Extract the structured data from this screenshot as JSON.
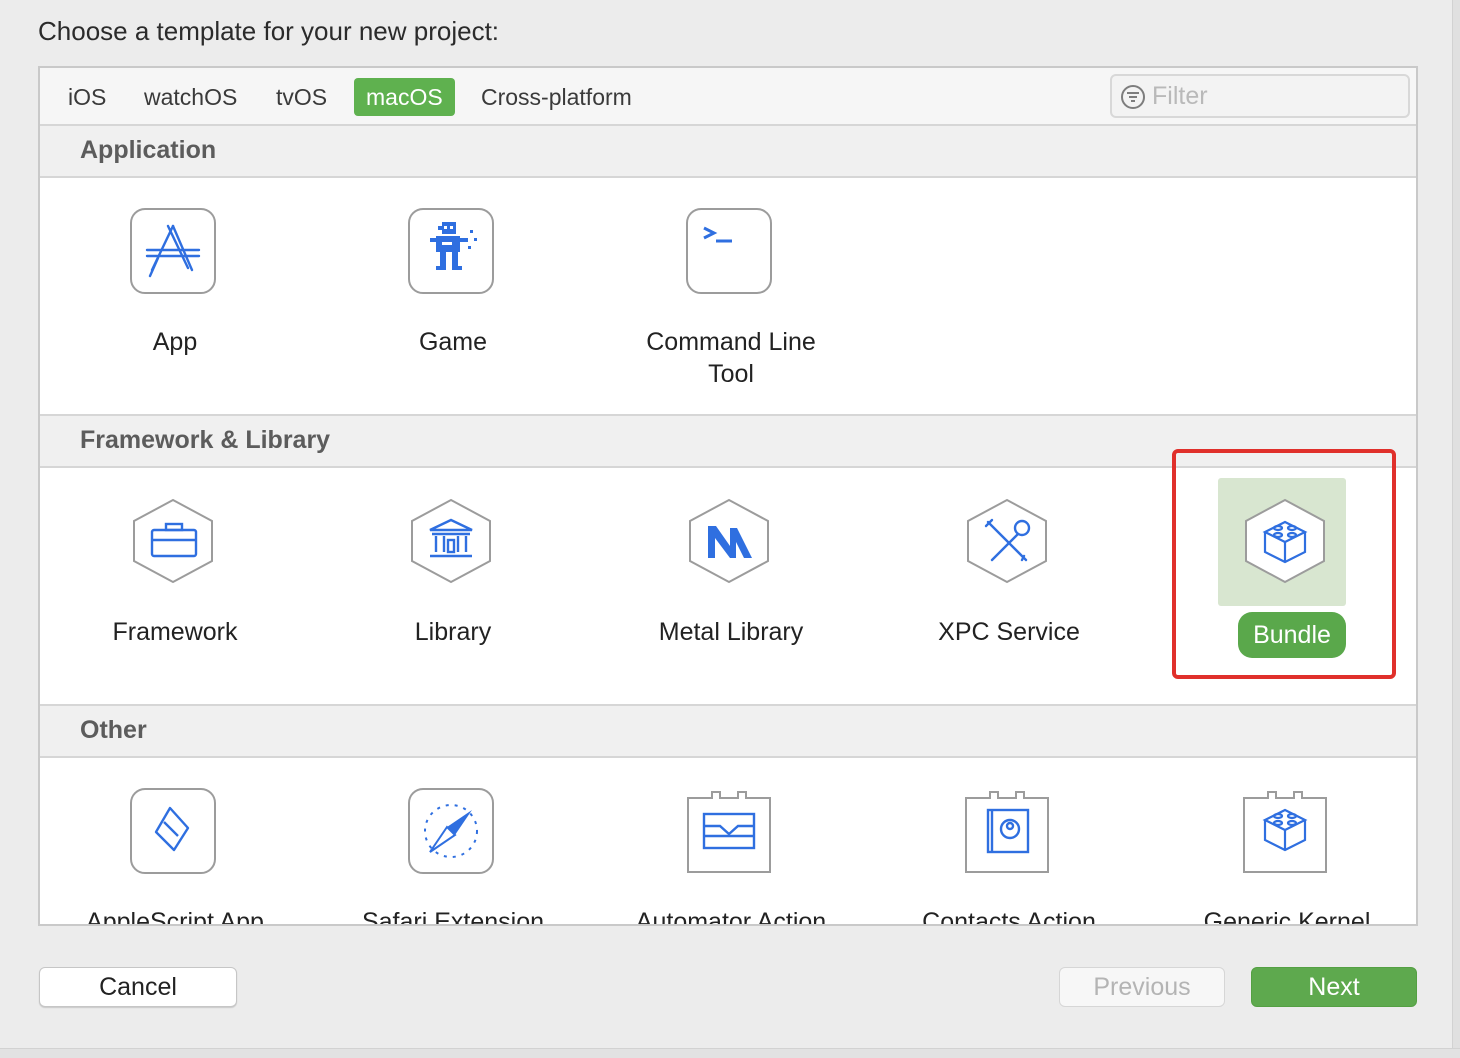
{
  "title": "Choose a template for your new project:",
  "tabs": [
    {
      "label": "iOS",
      "active": false
    },
    {
      "label": "watchOS",
      "active": false
    },
    {
      "label": "tvOS",
      "active": false
    },
    {
      "label": "macOS",
      "active": true
    },
    {
      "label": "Cross-platform",
      "active": false
    }
  ],
  "filter": {
    "placeholder": "Filter",
    "value": "",
    "icon": "filter-icon"
  },
  "sections": [
    {
      "header": "Application",
      "items": [
        {
          "label": "App",
          "icon": "app-store-icon"
        },
        {
          "label": "Game",
          "icon": "game-robot-icon"
        },
        {
          "label": "Command Line Tool",
          "line1": "Command Line",
          "line2": "Tool",
          "icon": "terminal-icon"
        }
      ]
    },
    {
      "header": "Framework & Library",
      "items": [
        {
          "label": "Framework",
          "icon": "toolbox-icon"
        },
        {
          "label": "Library",
          "icon": "library-building-icon"
        },
        {
          "label": "Metal Library",
          "icon": "metal-icon"
        },
        {
          "label": "XPC Service",
          "icon": "wrench-screwdriver-icon"
        },
        {
          "label": "Bundle",
          "icon": "lego-block-icon",
          "selected": true
        }
      ]
    },
    {
      "header": "Other",
      "items": [
        {
          "label": "AppleScript App",
          "icon": "applescript-scroll-icon"
        },
        {
          "label": "Safari Extension",
          "icon": "safari-compass-icon"
        },
        {
          "label": "Automator Action",
          "icon": "automator-action-icon"
        },
        {
          "label": "Contacts Action",
          "icon": "contacts-action-icon"
        },
        {
          "label": "Generic Kernel",
          "icon": "kernel-extension-icon"
        }
      ]
    }
  ],
  "buttons": {
    "cancel": "Cancel",
    "previous": "Previous",
    "next": "Next",
    "previous_enabled": false
  },
  "colors": {
    "accent_green": "#5fb14f",
    "icon_blue": "#2f6fe0",
    "highlight_red": "#e0302b"
  }
}
